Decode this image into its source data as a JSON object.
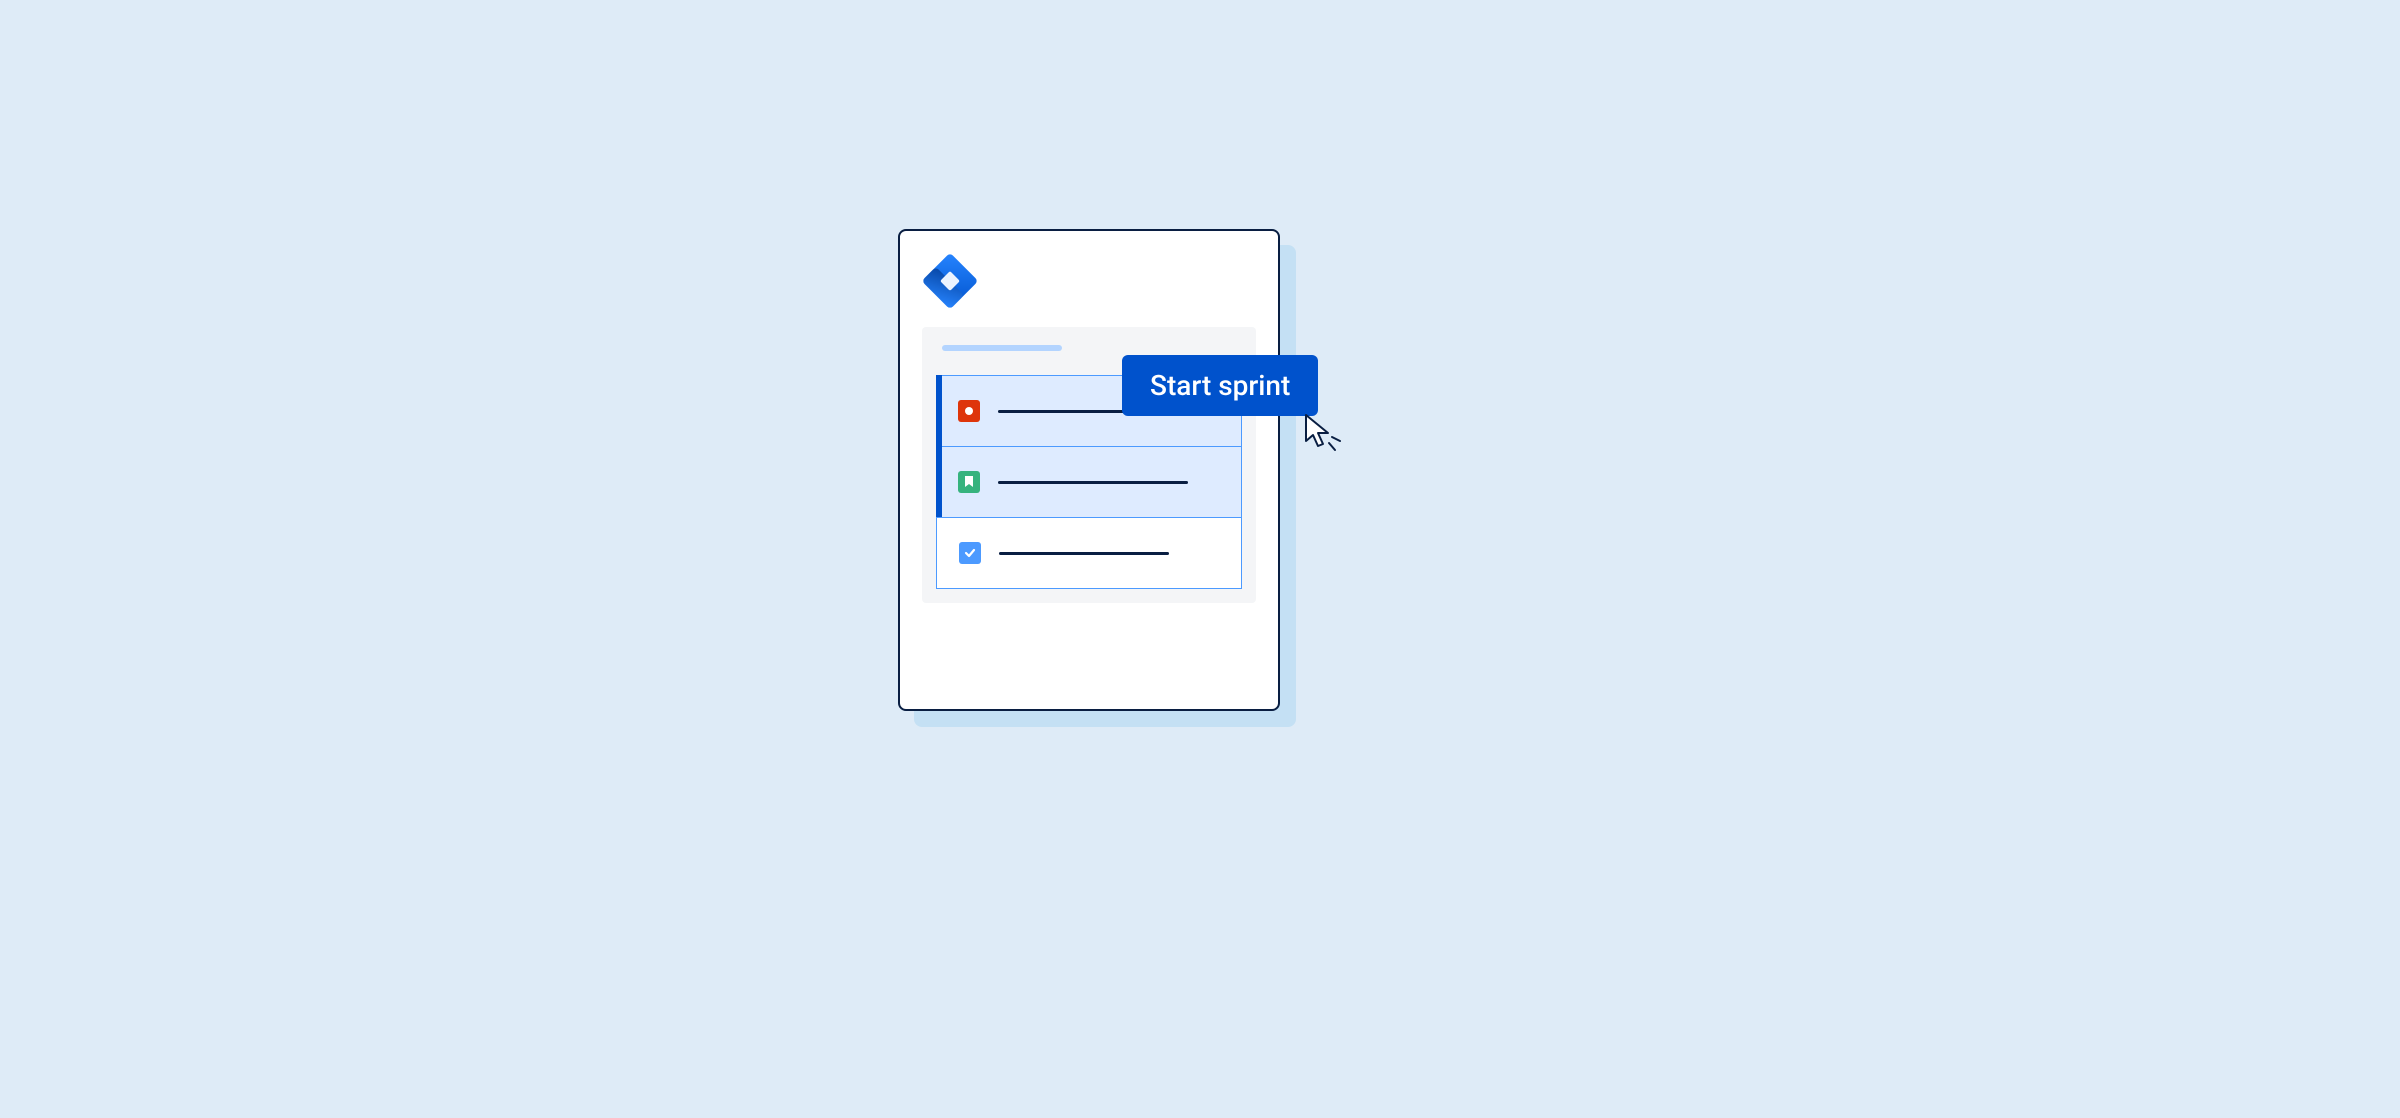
{
  "button": {
    "label": "Start sprint"
  },
  "colors": {
    "background": "#deebf7",
    "card_bg": "#ffffff",
    "card_border": "#091e42",
    "panel_bg": "#f4f5f7",
    "row_selected_bg": "#deebff",
    "row_border": "#4c9aff",
    "accent": "#0052cc",
    "button_bg": "#0052cc",
    "button_text": "#ffffff",
    "title_bar": "#b3d4ff",
    "shadow": "#c4e0f4",
    "bug": "#de350b",
    "story": "#36b37e",
    "task": "#4c9aff"
  },
  "rows": [
    {
      "type": "bug",
      "selected": true,
      "line_width": 140
    },
    {
      "type": "story",
      "selected": true,
      "line_width": 190
    },
    {
      "type": "task",
      "selected": false,
      "line_width": 170
    }
  ],
  "icons": {
    "logo": "jira-logo",
    "bug": "bug-icon",
    "story": "story-icon",
    "task": "task-icon",
    "cursor": "cursor-click-icon"
  }
}
